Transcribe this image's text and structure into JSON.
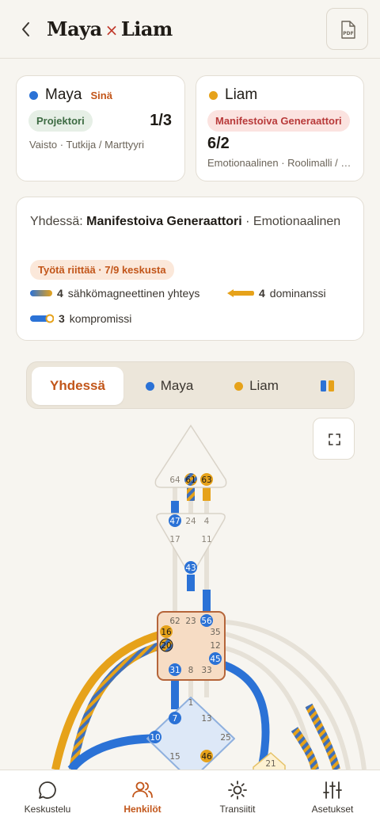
{
  "header": {
    "name_a": "Maya",
    "separator": "×",
    "name_b": "Liam",
    "pdf_label": "PDF"
  },
  "person_a": {
    "name": "Maya",
    "you_label": "Sinä",
    "type": "Projektori",
    "profile": "1/3",
    "gates": "Vaisto · Tutkija / Marttyyri",
    "color": "#2b72d6"
  },
  "person_b": {
    "name": "Liam",
    "type": "Manifestoiva Generaattori",
    "profile": "6/2",
    "gates": "Emotionaalinen · Roolimalli / Erakko",
    "color": "#e6a21a"
  },
  "combined": {
    "prefix": "Yhdessä:",
    "type": "Manifestoiva Generaattori",
    "suffix": "· Emotionaalinen",
    "work_pill": "Työtä riittää · 7/9 keskusta",
    "legend": [
      {
        "count": "4",
        "label": "sähkömagneettinen yhteys"
      },
      {
        "count": "4",
        "label": "dominanssi"
      },
      {
        "count": "3",
        "label": "kompromissi"
      }
    ]
  },
  "segments": {
    "together": "Yhdessä",
    "maya": "Maya",
    "liam": "Liam",
    "active": "Yhdessä"
  },
  "gates": {
    "head": [
      "64",
      "61",
      "63"
    ],
    "ajna": [
      "47",
      "24",
      "4",
      "17",
      "11",
      "43"
    ],
    "throat": [
      "62",
      "23",
      "56",
      "16",
      "35",
      "20",
      "12",
      "31",
      "8",
      "33",
      "45"
    ],
    "g": [
      "1",
      "13",
      "7",
      "10",
      "25",
      "15",
      "46"
    ],
    "other": [
      "21"
    ]
  },
  "tabs": [
    {
      "label": "Keskustelu",
      "icon": "chat-icon"
    },
    {
      "label": "Henkilöt",
      "icon": "people-icon",
      "active": true
    },
    {
      "label": "Transiitit",
      "icon": "sun-icon"
    },
    {
      "label": "Asetukset",
      "icon": "sliders-icon"
    }
  ],
  "colors": {
    "accent": "#c2561a",
    "blue": "#2b72d6",
    "yellow": "#e6a21a"
  }
}
